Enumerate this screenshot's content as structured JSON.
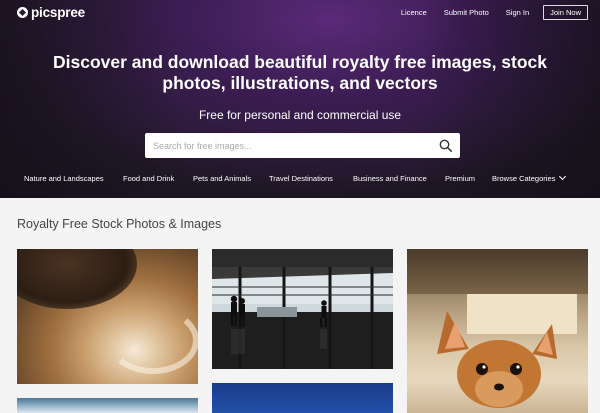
{
  "header": {
    "logo_text": "picspree",
    "nav": {
      "licence": "Licence",
      "submit_photo": "Submit Photo",
      "sign_in": "Sign In",
      "join_now": "Join Now"
    }
  },
  "hero": {
    "headline": "Discover and download beautiful royalty free images, stock photos, illustrations, and vectors",
    "subline": "Free for personal and commercial use",
    "search": {
      "placeholder": "Search for free images...",
      "value": ""
    }
  },
  "categories": [
    "Nature and Landscapes",
    "Food and Drink",
    "Pets and Animals",
    "Travel Destinations",
    "Business and Finance",
    "Premium",
    "Browse Categories"
  ],
  "main": {
    "section_title": "Royalty Free Stock Photos & Images"
  },
  "icons": {
    "logo": "picspree-logo-icon",
    "search": "search-icon",
    "browse_dropdown": "chevron-down-icon"
  },
  "colors": {
    "hero_bg": "#2a1c34",
    "hero_accent": "#5a2a78",
    "page_bg": "#f4f4f4",
    "text_white": "#ffffff"
  }
}
